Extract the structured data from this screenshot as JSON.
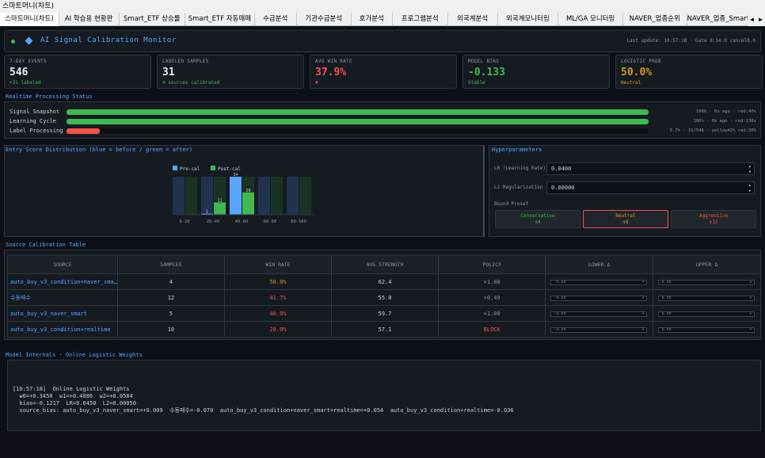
{
  "window": {
    "title": "스마트머니(차트)"
  },
  "tabs": [
    {
      "label": "스마트머니(차트)",
      "width": 76,
      "active": true
    },
    {
      "label": "AI 학습용 현황판",
      "width": 77
    },
    {
      "label": "Smart_ETF 상승률",
      "width": 85
    },
    {
      "label": "Smart_ETF 자동매매",
      "width": 89
    },
    {
      "label": "수급분석",
      "width": 54
    },
    {
      "label": "기관수급분석",
      "width": 70
    },
    {
      "label": "호가분석",
      "width": 53
    },
    {
      "label": "프로그램분석",
      "width": 71
    },
    {
      "label": "외국계분석",
      "width": 64
    },
    {
      "label": "외국계모니터링",
      "width": 78
    },
    {
      "label": "ML/GA 모니터링",
      "width": 83
    },
    {
      "label": "NAVER_업종순위",
      "width": 82
    },
    {
      "label": "NAVER_업종_Smart_Buy",
      "width": 100
    }
  ],
  "tab_nav": {
    "prev": "◀",
    "next": "▶"
  },
  "header": {
    "title": "AI Signal Calibration Monitor",
    "meta": "Last update: 10:57:18  ·  Gate  8:14.0  cancel0.0"
  },
  "kpis": [
    {
      "label": "7-DAY EVENTS",
      "value": "546",
      "sub": "+31 labeled",
      "value_color": "#e6edf3",
      "sub_color": "#3fb950"
    },
    {
      "label": "LABELED SAMPLES",
      "value": "31",
      "sub": "4 sources calibrated",
      "value_color": "#e6edf3",
      "sub_color": "#3fb950"
    },
    {
      "label": "AVG WIN RATE",
      "value": "37.9%",
      "sub": "▼",
      "value_color": "#f85149",
      "sub_color": "#f85149"
    },
    {
      "label": "MODEL BIAS",
      "value": "-0.133",
      "sub": "Stable",
      "value_color": "#3fb950",
      "sub_color": "#3fb950"
    },
    {
      "label": "LOGISTIC PROB",
      "value": "50.0%",
      "sub": "Neutral",
      "value_color": "#d29922",
      "sub_color": "#d29922"
    }
  ],
  "realtime": {
    "title": "Realtime Processing Status",
    "rows": [
      {
        "name": "Signal Snapshot",
        "progress": 1.0,
        "color": "#3fb950",
        "meta": "100%  ·  0s ago  ·  red:40s"
      },
      {
        "name": "Learning Cycle",
        "progress": 1.0,
        "color": "#3fb950",
        "meta": "100%  ·  0s ago  ·  red:138s"
      },
      {
        "name": "Label Processing",
        "progress": 0.057,
        "color": "#f85149",
        "meta": "5.7%  ·  31/546  ·  yellow42% red:30%"
      }
    ]
  },
  "distribution": {
    "title": "Entry Score Distribution  (blue = before / green = after)"
  },
  "chart_data": {
    "type": "bar",
    "categories": [
      "0-20",
      "20-40",
      "40-60",
      "60-80",
      "80-100"
    ],
    "series": [
      {
        "name": "Pre-cal",
        "color": "#58a6ff",
        "values": [
          0,
          1,
          34,
          0,
          0
        ]
      },
      {
        "name": "Post-cal",
        "color": "#3fb950",
        "values": [
          0,
          11,
          20,
          0,
          0
        ]
      }
    ],
    "data_labels": [
      "1",
      "11",
      "20",
      "34"
    ],
    "ylim": [
      0,
      34
    ],
    "legend": "top-left",
    "grid": false
  },
  "hyperparameters": {
    "title": "Hyperparameters",
    "lr_label": "LR (Learning Rate)",
    "lr_value": "0.0400",
    "l2_label": "L2 Regularization",
    "l2_value": "0.00000",
    "preset_label": "Bound Preset",
    "presets": [
      {
        "name": "Conservative",
        "value": "±4",
        "color": "#3fb950",
        "border": "#30363d"
      },
      {
        "name": "Neutral",
        "value": "±8",
        "color": "#d29922",
        "border": "#f85149"
      },
      {
        "name": "Aggressive",
        "value": "±12",
        "color": "#f85149",
        "border": "#30363d"
      }
    ]
  },
  "source_table": {
    "title": "Source Calibration Table",
    "columns": [
      "SOURCE",
      "SAMPLES",
      "WIN RATE",
      "AVG STRENGTH",
      "POLICY",
      "LOWER Δ",
      "UPPER Δ"
    ],
    "rows": [
      {
        "source": "auto_buy_v3_condition+naver_sma…",
        "samples": "4",
        "win_rate": "50.0%",
        "win_color": "#d29922",
        "avg_strength": "62.4",
        "policy": "×1.00",
        "policy_color": "#8b949e",
        "lower": "-x.xx",
        "upper": "x.xx"
      },
      {
        "source": "수동매수",
        "samples": "12",
        "win_rate": "41.7%",
        "win_color": "#f85149",
        "avg_strength": "55.0",
        "policy": "×0.49",
        "policy_color": "#8b949e",
        "lower": "-x.xx",
        "upper": "x.xx"
      },
      {
        "source": "auto_buy_v3_naver_smart",
        "samples": "5",
        "win_rate": "40.0%",
        "win_color": "#f85149",
        "avg_strength": "59.7",
        "policy": "×1.00",
        "policy_color": "#8b949e",
        "lower": "-x.xx",
        "upper": "x.xx"
      },
      {
        "source": "auto_buy_v3_condition+realtime",
        "samples": "10",
        "win_rate": "20.0%",
        "win_color": "#f85149",
        "avg_strength": "57.1",
        "policy": "BLOCK",
        "policy_color": "#f85149",
        "lower": "-x.xx",
        "upper": "x.xx"
      }
    ]
  },
  "internals": {
    "title": "Model Internals  ·  Online Logistic Weights",
    "log_lines": [
      "[10:57:18]  Online Logistic Weights",
      "  w0=+0.3450  w1=+0.4886  w2=+0.0584",
      "  bias=-0.1217  LR=0.0450  L2=0.00050",
      "  source_bias: auto_buy_v3_naver_smart=+0.009  수동매수=-0.070  auto_buy_v3_condition+naver_smart+realtime=+0.054  auto_buy_v3_condition+realtime=-0.036"
    ]
  }
}
